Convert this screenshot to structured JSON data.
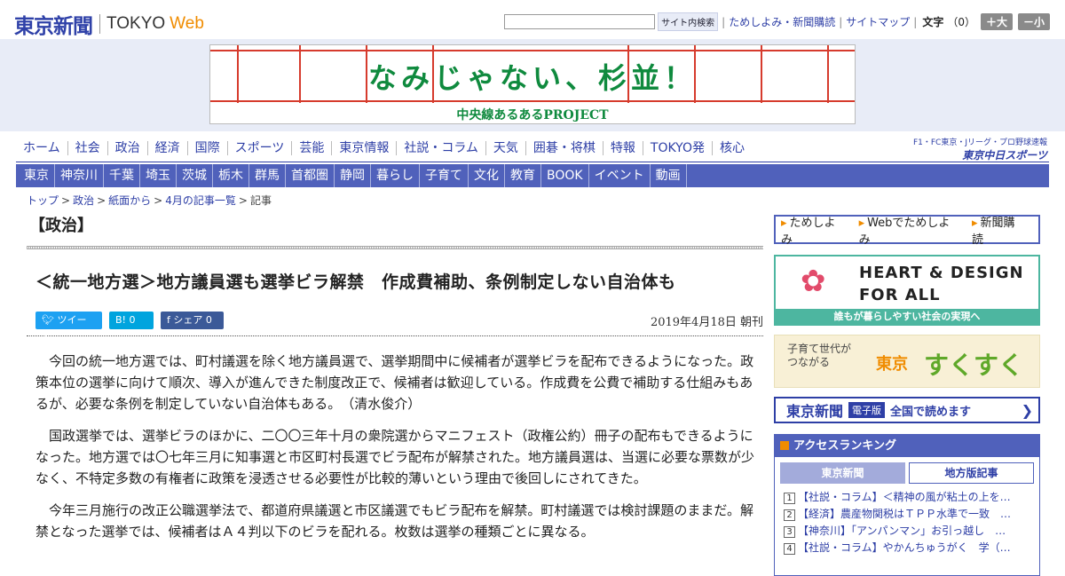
{
  "header": {
    "logo_jp": "東京新聞",
    "logo_en": "TOKYO",
    "logo_web": "Web",
    "search_placeholder": "",
    "search_button": "サイト内検索",
    "links": [
      "ためしよみ・新聞購読",
      "サイトマップ"
    ],
    "font_label": "文字",
    "font_value": "（0）",
    "font_bigger": "＋大",
    "font_smaller": "－小"
  },
  "banner": {
    "title": "なみじゃない、杉並！",
    "subtitle": "中央線あるあるPROJECT"
  },
  "nav": {
    "primary": [
      "ホーム",
      "社会",
      "政治",
      "経済",
      "国際",
      "スポーツ",
      "芸能",
      "東京情報",
      "社説・コラム",
      "天気",
      "囲碁・将棋",
      "特報",
      "TOKYO発",
      "核心"
    ],
    "partner_top": "F1・FC東京・Jリーグ・プロ野球速報",
    "partner_logo": "東京中日スポーツ",
    "regional": [
      "東京",
      "神奈川",
      "千葉",
      "埼玉",
      "茨城",
      "栃木",
      "群馬",
      "首都圏",
      "静岡",
      "暮らし",
      "子育て",
      "文化",
      "教育",
      "BOOK",
      "イベント",
      "動画"
    ]
  },
  "breadcrumb": [
    "トップ",
    "政治",
    "紙面から",
    "4月の記事一覧",
    "記事"
  ],
  "article": {
    "section": "【政治】",
    "headline": "＜統一地方選＞地方議員選も選挙ビラ解禁　作成費補助、条例制定しない自治体も",
    "share_tweet": "ツイート",
    "share_hatena": "B! 0",
    "share_facebook": "f シェア 0",
    "date": "2019年4月18日 朝刊",
    "paragraphs": [
      "今回の統一地方選では、町村議選を除く地方議員選で、選挙期間中に候補者が選挙ビラを配布できるようになった。政策本位の選挙に向けて順次、導入が進んできた制度改正で、候補者は歓迎している。作成費を公費で補助する仕組みもあるが、必要な条例を制定していない自治体もある。　（清水俊介）",
      "国政選挙では、選挙ビラのほかに、二〇〇三年十月の衆院選からマニフェスト（政権公約）冊子の配布もできるようになった。地方選では〇七年三月に知事選と市区町村長選でビラ配布が解禁された。地方議員選は、当選に必要な票数が少なく、不特定多数の有権者に政策を浸透させる必要性が比較的薄いという理由で後回しにされてきた。",
      "今年三月施行の改正公職選挙法で、都道府県議選と市区議選でもビラ配布を解禁。町村議選では検討課題のままだ。解禁となった選挙では、候補者はＡ４判以下のビラを配れる。枚数は選挙の種類ごとに異なる。"
    ]
  },
  "sidebar": {
    "subscribe": [
      "ためしよみ",
      "Webでためしよみ",
      "新聞購読"
    ],
    "hd_line1": "HEART & DESIGN",
    "hd_line2": "FOR ALL",
    "hd_caption": "誰もが暮らしやすい社会の実現へ",
    "suku_small": "子育て世代が\nつながる",
    "suku_tokyo": "東京",
    "suku_big": "すくすく",
    "epaper_logo": "東京新聞",
    "epaper_badge": "電子版",
    "epaper_text": "全国で読めます",
    "ranking_title": "アクセスランキング",
    "ranking_tabs": [
      "東京新聞",
      "地方版記事"
    ],
    "ranking": [
      "【社説・コラム】＜精神の風が粘土の上を…",
      "【経済】農産物関税はＴＰＰ水準で一致　…",
      "【神奈川】「アンパンマン」お引っ越し　…",
      "【社説・コラム】やかんちゅうがく　学（…"
    ]
  }
}
